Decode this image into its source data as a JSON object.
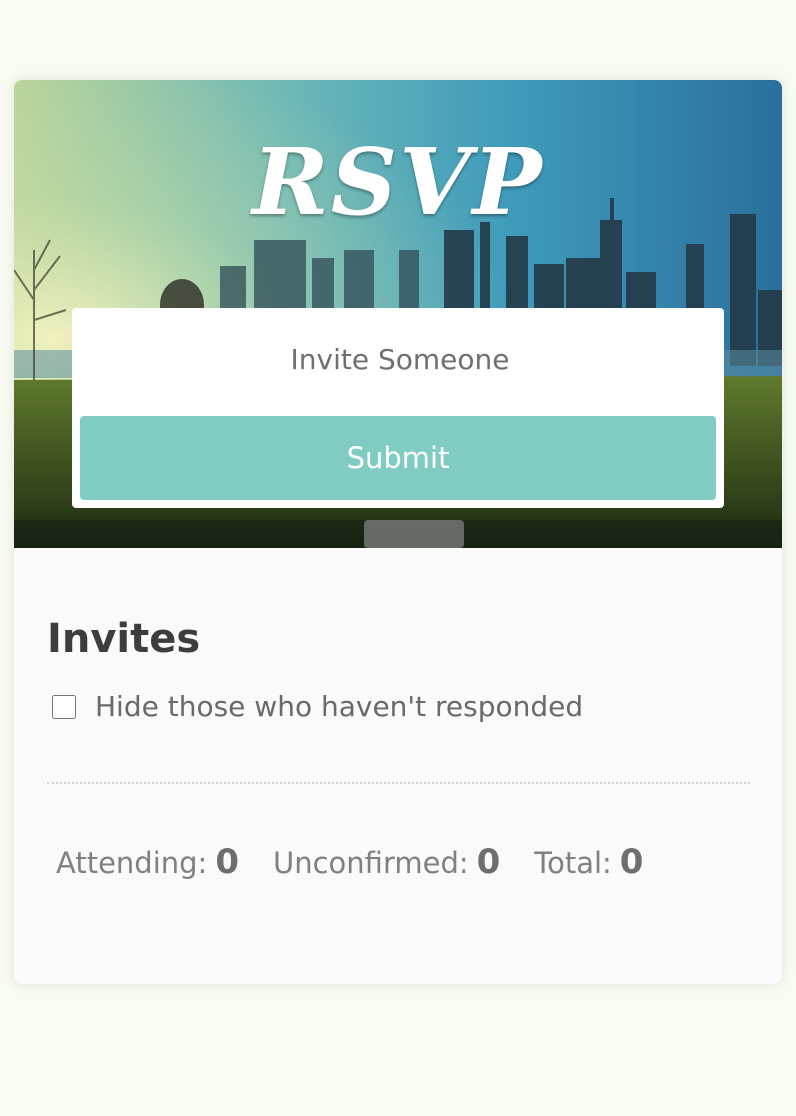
{
  "header": {
    "title": "RSVP"
  },
  "form": {
    "invite_placeholder": "Invite Someone",
    "submit_label": "Submit"
  },
  "invites": {
    "heading": "Invites",
    "hide_label": "Hide those who haven't responded",
    "hide_checked": false
  },
  "stats": {
    "attending_label": "Attending:",
    "attending_value": "0",
    "unconfirmed_label": "Unconfirmed:",
    "unconfirmed_value": "0",
    "total_label": "Total:",
    "total_value": "0"
  },
  "colors": {
    "page_background": "#f7fbf1",
    "card_background": "#fafafa",
    "accent": "#80ccc2",
    "heading_text": "#3d3d3d",
    "body_text": "#6a6a6a"
  }
}
